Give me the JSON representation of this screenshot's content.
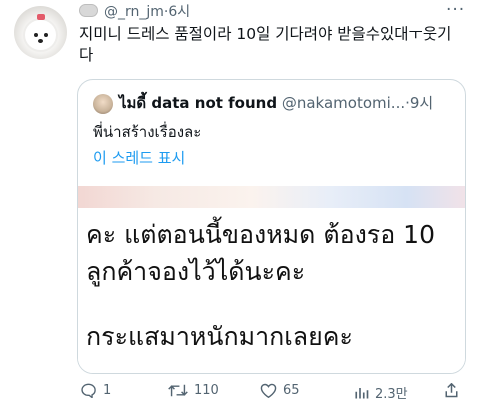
{
  "tweet": {
    "handle": "@_rn_jm",
    "separator": "·",
    "time": "6시",
    "text": "지미니 드레스 품절이라 10일 기다려야 받을수있대ㅜ웃기다"
  },
  "quote": {
    "display_name": "ไมดี้ data not found",
    "handle": "@nakamotomi...",
    "separator": "·",
    "time": "9시",
    "body": "พี่น่าสร้างเรื่องละ",
    "thread_link": "이 스레드 표시",
    "image_text": {
      "line1": "คะ แต่ตอนนี้ของหมด ต้องรอ 10",
      "line2": "ลูกค้าจองไว้ได้นะคะ",
      "line3": "กระแสมาหนักมากเลยคะ"
    }
  },
  "actions": {
    "reply_count": "1",
    "retweet_count": "110",
    "like_count": "65",
    "views_count": "2.3만"
  },
  "colors": {
    "text": "#0f1419",
    "secondary": "#536471",
    "link": "#1d9bf0",
    "border": "#cfd9de"
  },
  "icons": [
    "more-icon",
    "reply-icon",
    "retweet-icon",
    "like-icon",
    "views-icon",
    "share-icon"
  ]
}
